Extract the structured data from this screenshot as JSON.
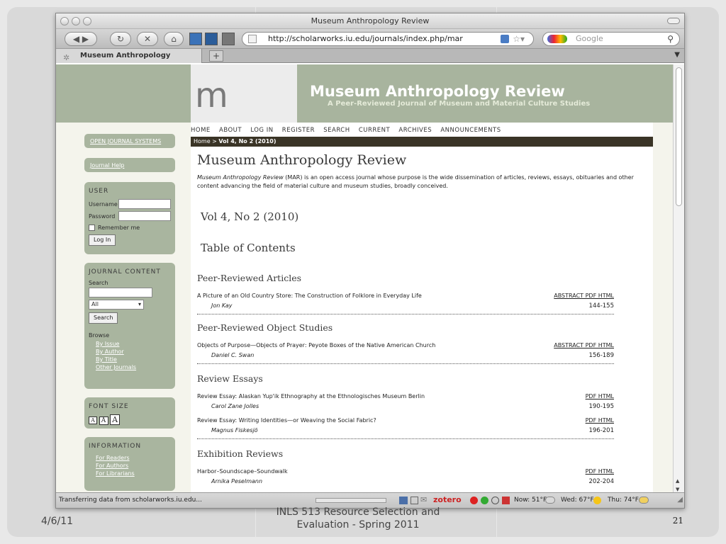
{
  "browser": {
    "window_title": "Museum Anthropology Review",
    "url": "http://scholarworks.iu.edu/journals/index.php/mar",
    "search_placeholder": "Google",
    "tab_title": "Museum Anthropology Review",
    "new_tab": "+",
    "status_text": "Transferring data from scholarworks.iu.edu...",
    "status_right": "zotero",
    "weather_now": "Now: 51°F",
    "weather_wed": "Wed: 67°F",
    "weather_thu": "Thu: 74°F"
  },
  "site": {
    "logo": "m a r",
    "title": "Museum Anthropology Review",
    "subtitle": "A Peer-Reviewed Journal of Museum and Material Culture Studies",
    "nav": [
      "HOME",
      "ABOUT",
      "LOG IN",
      "REGISTER",
      "SEARCH",
      "CURRENT",
      "ARCHIVES",
      "ANNOUNCEMENTS"
    ],
    "breadcrumb_home": "Home",
    "breadcrumb_sep": ">",
    "breadcrumb_current": "Vol 4, No 2 (2010)"
  },
  "sidebar": {
    "ojs": "OPEN JOURNAL SYSTEMS",
    "help": "Journal Help",
    "user_heading": "USER",
    "username_label": "Username",
    "password_label": "Password",
    "remember_label": "Remember me",
    "login_button": "Log In",
    "content_heading": "JOURNAL CONTENT",
    "search_label": "Search",
    "scope_value": "All",
    "search_button": "Search",
    "browse_label": "Browse",
    "browse_links": [
      "By Issue",
      "By Author",
      "By Title",
      "Other Journals"
    ],
    "font_heading": "FONT SIZE",
    "font_sizes": [
      "A",
      "A",
      "A"
    ],
    "info_heading": "INFORMATION",
    "info_links": [
      "For Readers",
      "For Authors",
      "For Librarians"
    ]
  },
  "main": {
    "page_title": "Museum Anthropology Review",
    "desc_italic": "Museum Anthropology Review",
    "desc_rest": " (MAR) is an open access journal whose purpose is the wide dissemination of articles, reviews, essays, obituaries and other content advancing the field of material culture and museum studies, broadly conceived.",
    "issue": "Vol 4, No 2 (2010)",
    "toc_heading": "Table of Contents",
    "sections": [
      {
        "title": "Peer-Reviewed Articles",
        "articles": [
          {
            "title": "A Picture of an Old Country Store: The Construction of Folklore in Everyday Life",
            "author": "Jon Kay",
            "links": "ABSTRACT PDF HTML",
            "pages": "144-155"
          }
        ]
      },
      {
        "title": "Peer-Reviewed Object Studies",
        "articles": [
          {
            "title": "Objects of Purpose—Objects of Prayer: Peyote Boxes of the Native American Church",
            "author": "Daniel C. Swan",
            "links": "ABSTRACT PDF HTML",
            "pages": "156-189"
          }
        ]
      },
      {
        "title": "Review Essays",
        "articles": [
          {
            "title": "Review Essay: Alaskan Yup'ik Ethnography at the Ethnologisches Museum Berlin",
            "author": "Carol Zane Jolles",
            "links": "PDF HTML",
            "pages": "190-195"
          },
          {
            "title": "Review Essay: Writing Identities—or Weaving the Social Fabric?",
            "author": "Magnus Fiskesjö",
            "links": "PDF HTML",
            "pages": "196-201"
          }
        ]
      },
      {
        "title": "Exhibition Reviews",
        "articles": [
          {
            "title": "Harbor–Soundscape–Soundwalk",
            "author": "Arnika Peselmann",
            "links": "PDF HTML",
            "pages": "202-204"
          }
        ]
      }
    ]
  },
  "slide": {
    "date": "4/6/11",
    "course_line1": "INLS 513 Resource Selection and",
    "course_line2": "Evaluation - Spring 2011",
    "number": "21"
  }
}
